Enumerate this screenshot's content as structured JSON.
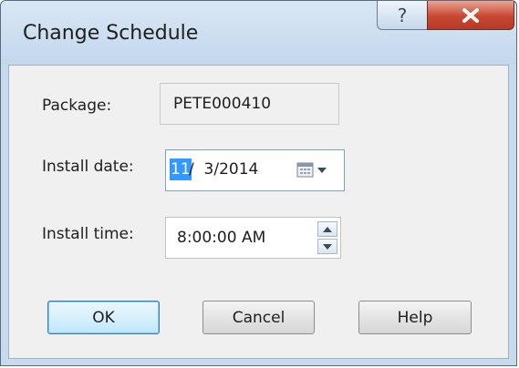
{
  "window": {
    "title": "Change Schedule",
    "help_glyph": "?",
    "close_glyph": "X"
  },
  "form": {
    "package": {
      "label": "Package:",
      "value": "PETE000410"
    },
    "install_date": {
      "label": "Install date:",
      "selected_part": "11",
      "rest": "/  3/2014",
      "icon": "calendar-icon"
    },
    "install_time": {
      "label": "Install time:",
      "value": "8:00:00 AM"
    }
  },
  "buttons": {
    "ok": "OK",
    "cancel": "Cancel",
    "help": "Help"
  },
  "colors": {
    "selection": "#3399ff",
    "close_button": "#c74732",
    "frame": "#c7daee"
  }
}
